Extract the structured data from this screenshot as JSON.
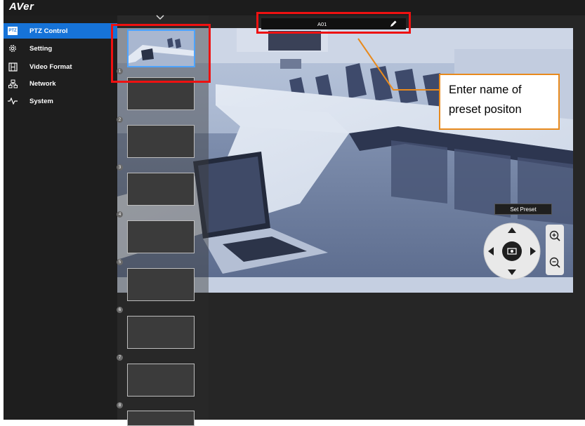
{
  "brand": {
    "logo_text": "AVer"
  },
  "sidebar": {
    "items": [
      {
        "label": "PTZ Control",
        "icon": "ptz-icon",
        "active": true
      },
      {
        "label": "Setting",
        "icon": "gear-icon",
        "active": false
      },
      {
        "label": "Video Format",
        "icon": "film-icon",
        "active": false
      },
      {
        "label": "Network",
        "icon": "network-icon",
        "active": false
      },
      {
        "label": "System",
        "icon": "pulse-icon",
        "active": false
      }
    ],
    "ptz_icon_text": "PTZ"
  },
  "presets": {
    "numbers": [
      "1",
      "2",
      "3",
      "4",
      "5",
      "6",
      "7",
      "8"
    ],
    "selected": "1"
  },
  "name_bar": {
    "value": "A01",
    "edit_icon": "pencil-icon"
  },
  "controls": {
    "set_preset_label": "Set Preset",
    "dpad_icons": [
      "arrow-up-icon",
      "arrow-left-icon",
      "center-focus-icon",
      "arrow-right-icon",
      "arrow-down-icon"
    ],
    "zoom_icons": [
      "zoom-in-icon",
      "zoom-out-icon"
    ]
  },
  "annotation": {
    "line1": "Enter name of",
    "line2": "preset positon"
  },
  "colors": {
    "accent": "#1673d8",
    "highlight": "#ee1111",
    "callout_border": "#e88a1d"
  }
}
